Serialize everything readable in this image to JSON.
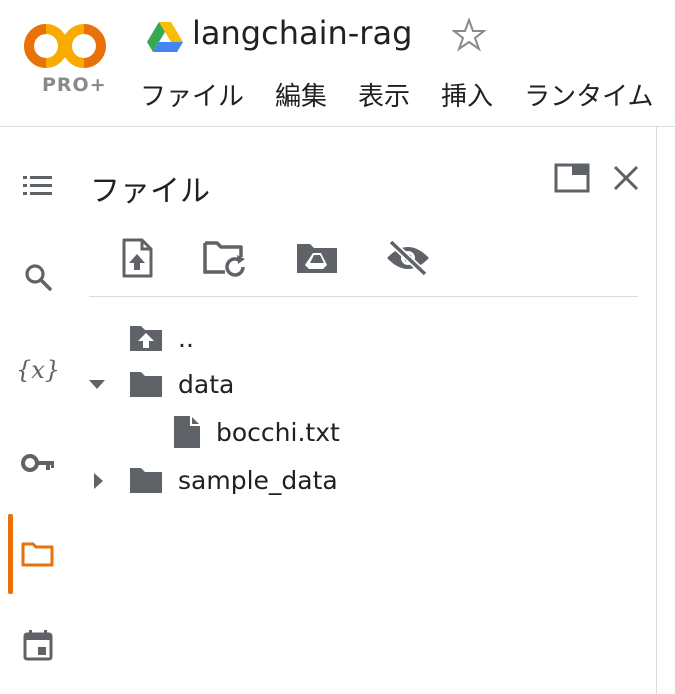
{
  "header": {
    "logo_badge": "PRO+",
    "notebook_title": "langchain-rag",
    "menu": [
      "ファイル",
      "編集",
      "表示",
      "挿入",
      "ランタイム"
    ]
  },
  "sidebar": {
    "rail": [
      "toc-icon",
      "search-icon",
      "variables-icon",
      "key-icon",
      "folder-icon",
      "calendar-icon"
    ],
    "variables_glyph": "{x}",
    "active": "folder-icon",
    "accent_color": "#e8710a"
  },
  "files_panel": {
    "title": "ファイル",
    "toolbar": [
      "upload-file-icon",
      "refresh-folder-icon",
      "mount-drive-icon",
      "hide-files-icon"
    ],
    "tree": [
      {
        "label": "..",
        "kind": "parent-folder"
      },
      {
        "label": "data",
        "kind": "folder",
        "expanded": true
      },
      {
        "label": "bocchi.txt",
        "kind": "file",
        "parent": "data"
      },
      {
        "label": "sample_data",
        "kind": "folder",
        "expanded": false
      }
    ]
  }
}
